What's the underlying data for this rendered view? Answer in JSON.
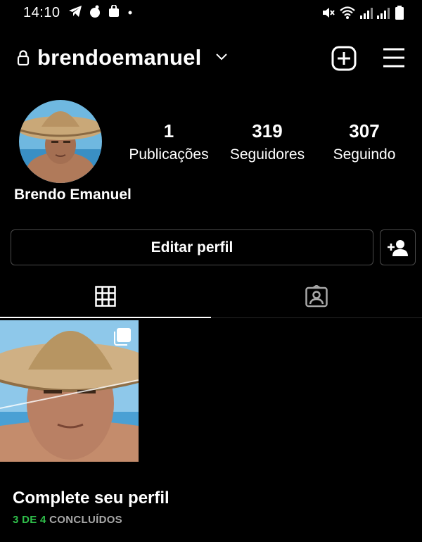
{
  "status_bar": {
    "time": "14:10",
    "icons": [
      "telegram-icon",
      "notification-icon",
      "bag-icon",
      "dot-icon",
      "mute-icon",
      "wifi-icon",
      "signal-icon",
      "battery-icon"
    ]
  },
  "header": {
    "username": "brendoemanuel",
    "icons": [
      "lock-icon",
      "chevron-down-icon",
      "new-post-icon",
      "menu-icon"
    ]
  },
  "profile": {
    "display_name": "Brendo Emanuel",
    "stats": [
      {
        "value": "1",
        "label": "Publicações"
      },
      {
        "value": "319",
        "label": "Seguidores"
      },
      {
        "value": "307",
        "label": "Seguindo"
      }
    ]
  },
  "actions": {
    "edit_label": "Editar perfil",
    "add_user_icon": "add-user-icon"
  },
  "tabs": [
    {
      "icon": "grid-icon",
      "active": true
    },
    {
      "icon": "tagged-icon",
      "active": false
    }
  ],
  "completion": {
    "title": "Complete seu perfil",
    "done": "3 DE 4",
    "rest": " CONCLUÍDOS"
  },
  "colors": {
    "background": "#000000",
    "text": "#ffffff",
    "border": "#4a4a4a",
    "progress_green": "#2fbf4a",
    "muted": "#a8a8a8"
  }
}
